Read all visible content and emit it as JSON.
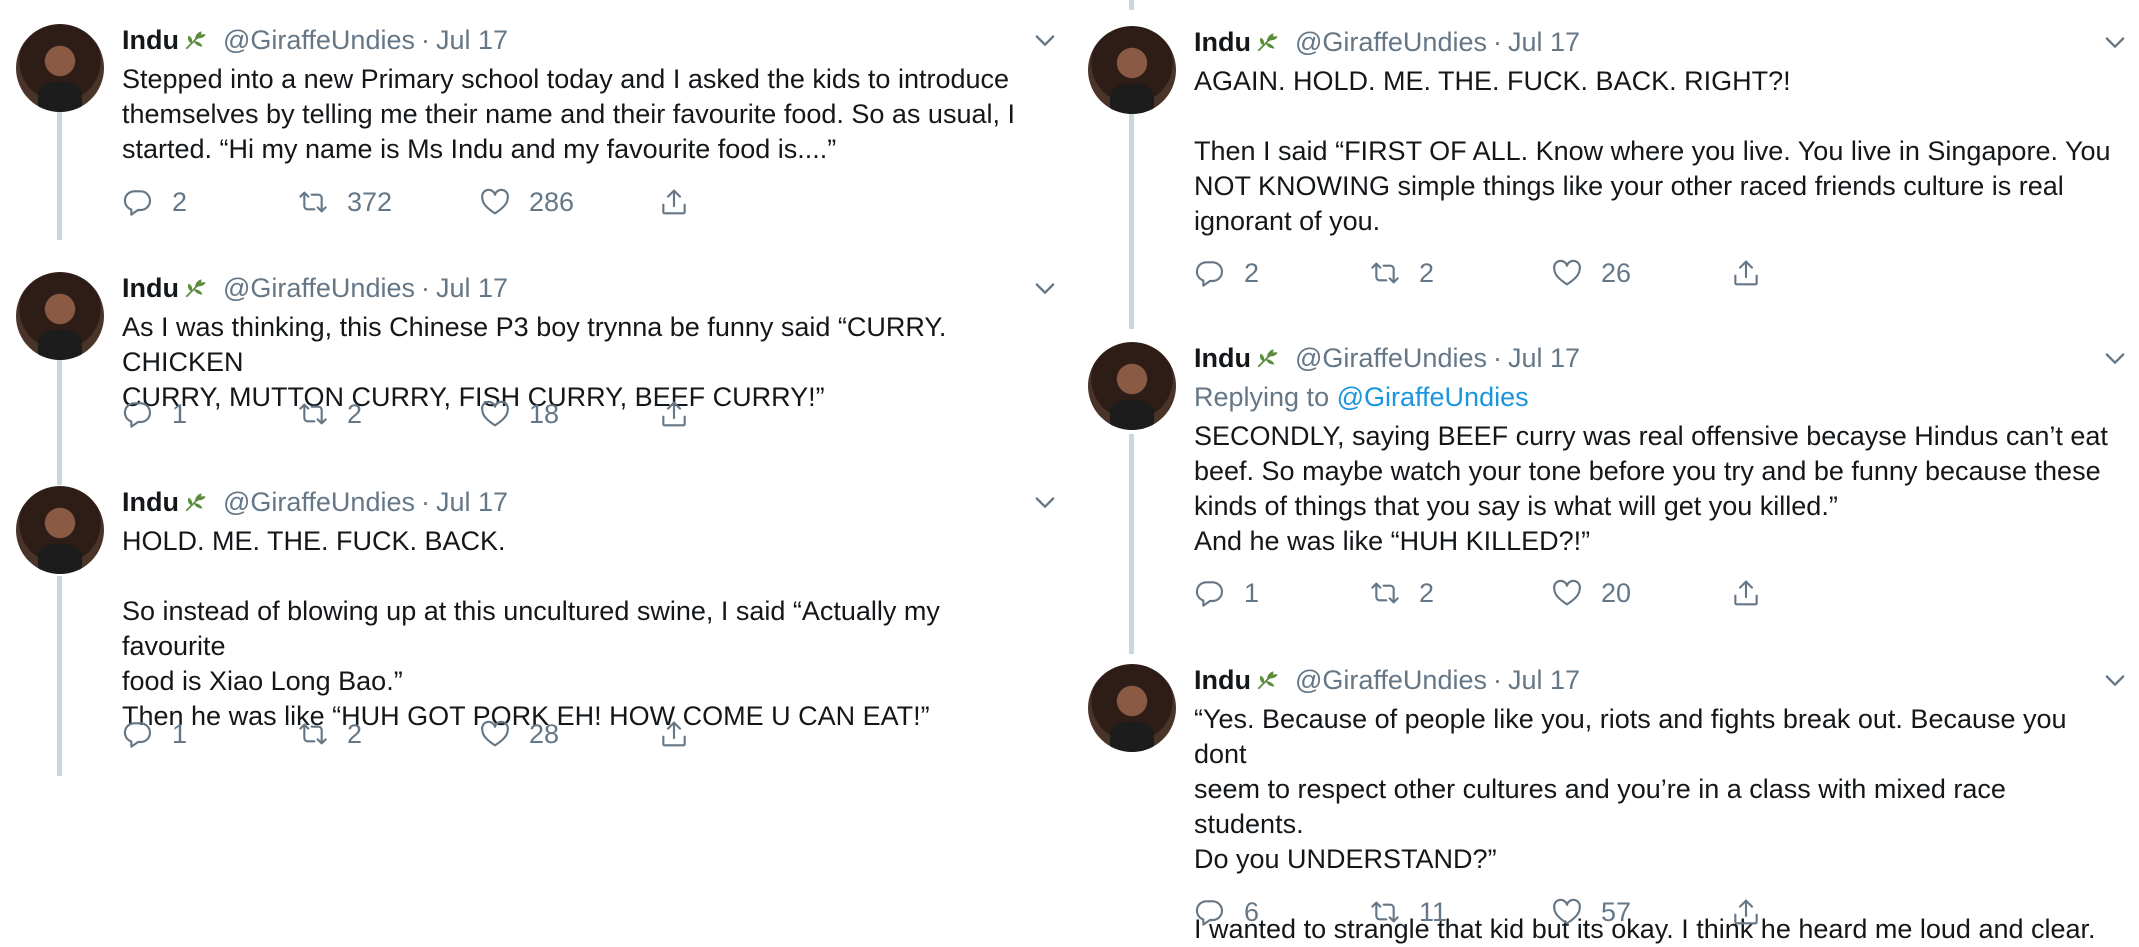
{
  "tweets_left": [
    {
      "name": "Indu",
      "handle": "@GiraffeUndies",
      "sep": "·",
      "date": "Jul 17",
      "reply_prefix": "",
      "reply_handle": "",
      "text": "Stepped into a new Primary school today and I asked the kids to introduce\nthemselves by telling me their name and their favourite food. So as usual, I\nstarted. “Hi my name is Ms Indu and my favourite food is....”",
      "replies": "2",
      "retweets": "372",
      "likes": "286"
    },
    {
      "name": "Indu",
      "handle": "@GiraffeUndies",
      "sep": "·",
      "date": "Jul 17",
      "reply_prefix": "",
      "reply_handle": "",
      "text": "As I was thinking, this Chinese P3 boy trynna be funny said “CURRY. CHICKEN\nCURRY, MUTTON CURRY, FISH CURRY, BEEF CURRY!”",
      "replies": "1",
      "retweets": "2",
      "likes": "18"
    },
    {
      "name": "Indu",
      "handle": "@GiraffeUndies",
      "sep": "·",
      "date": "Jul 17",
      "reply_prefix": "",
      "reply_handle": "",
      "text": "HOLD. ME. THE. FUCK. BACK.\n\nSo instead of blowing up at this uncultured swine, I said “Actually my favourite\nfood is Xiao Long Bao.”\nThen he was like “HUH GOT PORK EH! HOW COME U CAN EAT!”",
      "replies": "1",
      "retweets": "2",
      "likes": "28"
    }
  ],
  "tweets_right": [
    {
      "name": "Indu",
      "handle": "@GiraffeUndies",
      "sep": "·",
      "date": "Jul 17",
      "reply_prefix": "",
      "reply_handle": "",
      "text": "AGAIN. HOLD. ME. THE. FUCK. BACK. RIGHT?!\n\nThen I said “FIRST OF ALL. Know where you live. You live in Singapore. You\nNOT KNOWING simple things like your other raced friends culture is real\nignorant of you.",
      "replies": "2",
      "retweets": "2",
      "likes": "26"
    },
    {
      "name": "Indu",
      "handle": "@GiraffeUndies",
      "sep": "·",
      "date": "Jul 17",
      "reply_prefix": "Replying to",
      "reply_handle": "@GiraffeUndies",
      "text": "SECONDLY, saying BEEF curry was real offensive becayse Hindus can’t eat\nbeef. So maybe watch your tone before you try and be funny because these\nkinds of things that you say is what will get you killed.”\nAnd he was like “HUH KILLED?!”",
      "replies": "1",
      "retweets": "2",
      "likes": "20"
    },
    {
      "name": "Indu",
      "handle": "@GiraffeUndies",
      "sep": "·",
      "date": "Jul 17",
      "reply_prefix": "",
      "reply_handle": "",
      "text": "“Yes. Because of people like you, riots and fights break out. Because you dont\nseem to respect other cultures and you’re in a class with mixed race students.\nDo you UNDERSTAND?”\n\nI wanted to strangle that kid but its okay. I think he heard me loud and clear.",
      "replies": "6",
      "retweets": "11",
      "likes": "57"
    }
  ],
  "colors": {
    "text": "#14171a",
    "muted": "#657786",
    "link": "#1b95e0",
    "thread_line": "#ccd6dd",
    "leaf": "#5b8c3a"
  },
  "icons": [
    "leaf-emoji-icon",
    "chevron-down-icon",
    "reply-icon",
    "retweet-icon",
    "like-icon",
    "share-icon"
  ]
}
